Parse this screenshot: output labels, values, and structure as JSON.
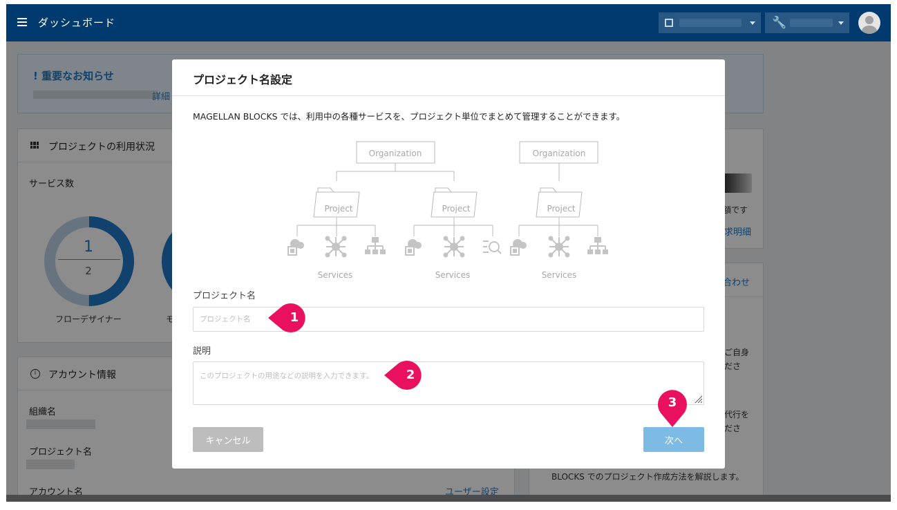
{
  "header": {
    "app_title": "ダッシュボード",
    "org_icon": "building-icon",
    "project_icon": "wrench-icon"
  },
  "notice": {
    "title": "重要なお知らせ",
    "link": "詳細"
  },
  "usage": {
    "title": "プロジェクトの利用状況",
    "service_count_label": "サービス数",
    "flow_designer": {
      "used": "1",
      "total": "2",
      "label": "フローデザイナー"
    },
    "second_label": "モ"
  },
  "account": {
    "title": "アカウント情報",
    "org_label": "組織名",
    "project_label": "プロジェクト名",
    "account_label": "アカウント名",
    "user_settings_link": "ユーザー設定"
  },
  "side": {
    "billing_text": "額です",
    "billing_link": "求明細",
    "contact_link": "合わせ",
    "line_a1": "ご自身",
    "line_a2": "ださ",
    "line_b1": "代行を",
    "line_b2": "ださ",
    "footer_text": "BLOCKS でのプロジェクト作成方法を解説します。"
  },
  "modal": {
    "title": "プロジェクト名設定",
    "description": "MAGELLAN BLOCKS では、利用中の各種サービスを、プロジェクト単位でまとめて管理することができます。",
    "diagram": {
      "organization_label": "Organization",
      "project_label": "Project",
      "services_label": "Services"
    },
    "project_name_label": "プロジェクト名",
    "project_name_placeholder": "プロジェクト名",
    "project_name_value": "",
    "description_label": "説明",
    "description_placeholder": "このプロジェクトの用途などの説明を入力できます。",
    "description_value": "",
    "cancel_label": "キャンセル",
    "next_label": "次へ"
  },
  "callouts": [
    "1",
    "2",
    "3"
  ],
  "colors": {
    "header_bg": "#003a6e",
    "link": "#1f78c8",
    "callout": "#e8105f",
    "next_button": "#7dbbe4",
    "cancel_button": "#bdbdbd"
  }
}
